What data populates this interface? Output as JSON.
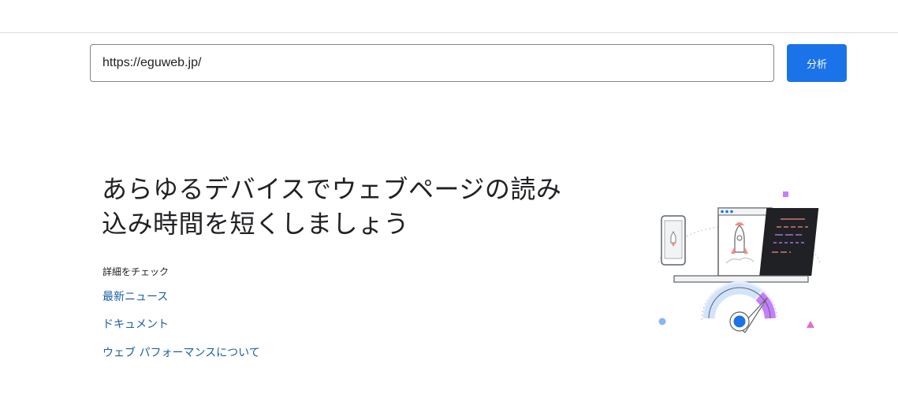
{
  "search": {
    "url_value": "https://eguweb.jp/",
    "analyze_label": "分析"
  },
  "hero": {
    "headline_line1": "あらゆるデバイスでウェブページの読み",
    "headline_line2": "込み時間を短くしましょう",
    "check_label": "詳細をチェック",
    "links": [
      {
        "label": "最新ニュース"
      },
      {
        "label": "ドキュメント"
      },
      {
        "label": "ウェブ パフォーマンスについて"
      }
    ]
  },
  "colors": {
    "accent_blue": "#1a73e8",
    "link_blue": "#1a5ea6",
    "gauge_purple": "#c77dff"
  },
  "illustration": {
    "icon": "speed-gauge-rocket-illustration"
  }
}
